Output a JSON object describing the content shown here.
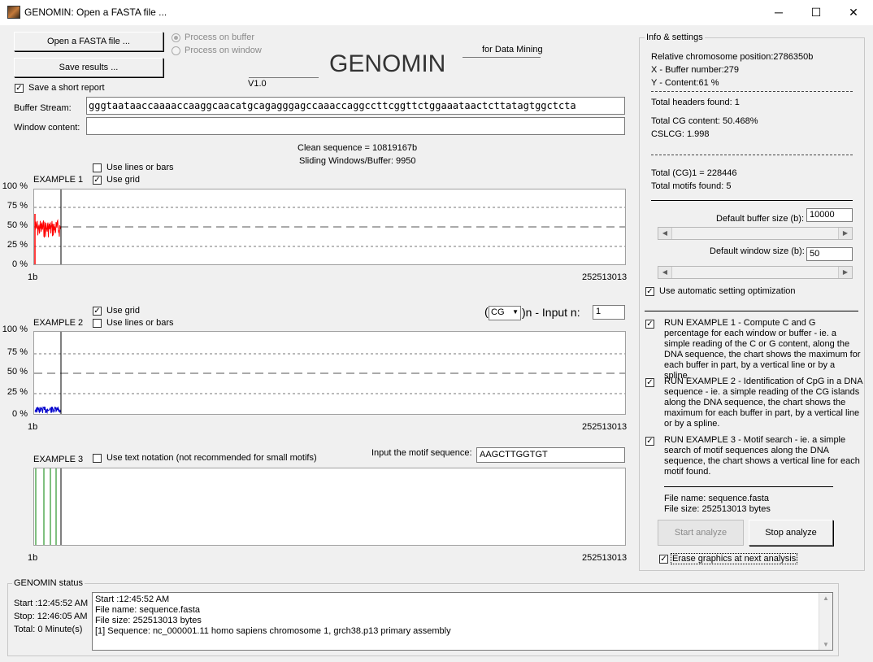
{
  "window": {
    "title": "GENOMIN: Open a FASTA file  ...",
    "minimize": "─",
    "maximize": "☐",
    "close": "✕"
  },
  "left": {
    "open_btn": "Open a FASTA file  ...",
    "save_btn": "Save results  ...",
    "radio_buffer": "Process on buffer",
    "radio_window": "Process on window",
    "save_report": "Save a short report",
    "logo": "GENOMIN",
    "version": "V1.0",
    "tagline": "for Data Mining",
    "buffer_label": "Buffer Stream:",
    "buffer_value": "gggtaataaccaaaaccaaggcaacatgcagagggagccaaaccaggccttcggttctggaaataactcttatagtggctcta",
    "window_label": "Window content:",
    "window_value": "",
    "clean_sequence": "Clean sequence = 10819167b",
    "sliding": "Sliding Windows/Buffer: 9950"
  },
  "example1": {
    "label": "EXAMPLE 1",
    "use_lines": "Use lines or bars",
    "use_grid": "Use grid",
    "y_ticks": [
      "100 %",
      "75 %",
      "50 %",
      "25 %",
      "0 %"
    ],
    "x_start": "1b",
    "x_end": "252513013"
  },
  "example2": {
    "label": "EXAMPLE 2",
    "use_grid": "Use grid",
    "use_lines": "Use lines or bars",
    "motif_select": "CG",
    "input_label": ")n - Input n:",
    "paren": "(",
    "input_n": "1",
    "y_ticks": [
      "100 %",
      "75 %",
      "50 %",
      "25 %",
      "0 %"
    ],
    "x_start": "1b",
    "x_end": "252513013"
  },
  "example3": {
    "label": "EXAMPLE 3",
    "use_text": "Use text notation (not recommended for small motifs)",
    "motif_label": "Input the motif sequence:",
    "motif_value": "AAGCTTGGTGT",
    "x_start": "1b",
    "x_end": "252513013"
  },
  "info": {
    "group_title": "Info & settings",
    "rel_pos": "Relative chromosome position:2786350b",
    "x_buffer": "X - Buffer number:279",
    "y_content": "Y - Content:61 %",
    "headers": "Total headers found: 1",
    "cg_content": "Total CG content: 50.468%",
    "cslcg": "CSLCG: 1.998",
    "total_cg1": "Total (CG)1 = 228446",
    "total_motifs": "Total motifs found: 5",
    "buffer_size_label": "Default buffer size (b):",
    "buffer_size": "10000",
    "window_size_label": "Default window size (b):",
    "window_size": "50",
    "auto_opt": "Use automatic setting optimization",
    "run1": "RUN EXAMPLE 1 - Compute C and G percentage for each window or buffer - ie. a simple reading of the C or G content, along the DNA sequence, the chart shows the maximum for each buffer in part, by a vertical line or by a spline.",
    "run2": "RUN EXAMPLE 2 - Identification of CpG in a DNA sequence  -  ie. a simple reading of the CG islands along the DNA sequence, the chart shows the maximum for each buffer in part, by a vertical line or by a spline.",
    "run3": "RUN EXAMPLE 3 - Motif search -  ie. a simple search of  motif sequences along the DNA sequence, the chart shows a vertical line for each motif found.",
    "file_name": "File name: sequence.fasta",
    "file_size": "File size: 252513013 bytes",
    "start_btn": "Start analyze",
    "stop_btn": "Stop analyze",
    "erase": "Erase graphics at next analysis"
  },
  "status": {
    "group_title": "GENOMIN status",
    "start": "Start :12:45:52 AM",
    "stop": "Stop: 12:46:05 AM",
    "total": "Total: 0 Minute(s)",
    "log": "Start :12:45:52 AM\nFile name: sequence.fasta\nFile size: 252513013 bytes\n[1] Sequence: nc_000001.11 homo sapiens chromosome 1, grch38.p13 primary assembly"
  },
  "colors": {
    "example1_series": "#ff0000",
    "example2_series": "#0000cc",
    "example3_series": "#008000"
  }
}
